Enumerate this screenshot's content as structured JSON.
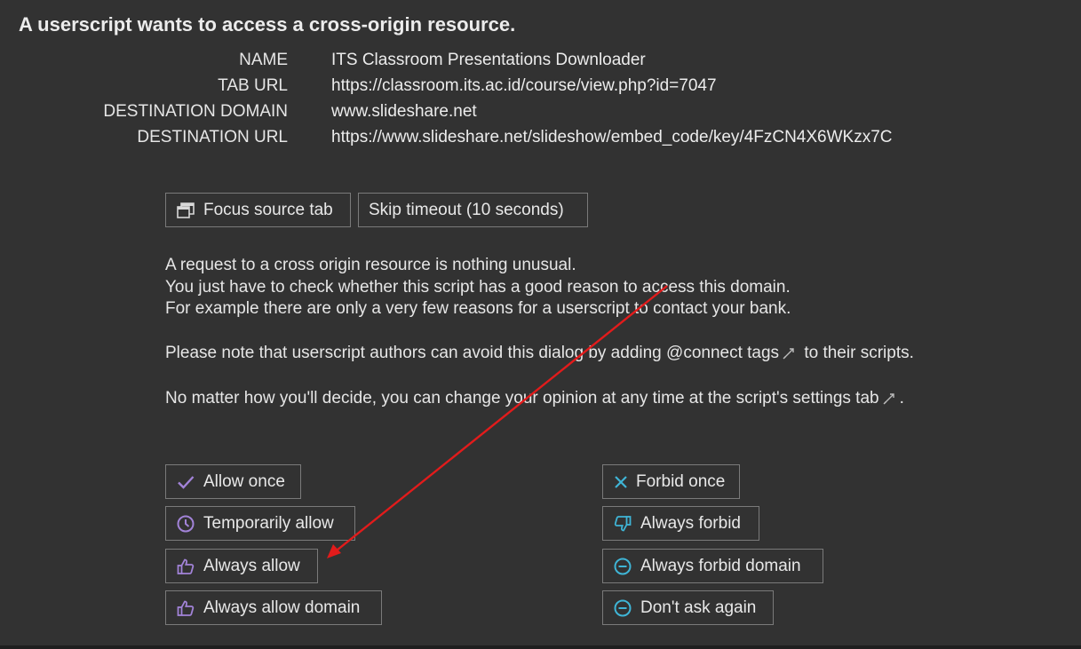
{
  "dialog": {
    "title": "A userscript wants to access a cross-origin resource."
  },
  "info": [
    {
      "key": "NAME",
      "value": "ITS Classroom Presentations Downloader"
    },
    {
      "key": "TAB URL",
      "value": "https://classroom.its.ac.id/course/view.php?id=7047"
    },
    {
      "key": "DESTINATION DOMAIN",
      "value": "www.slideshare.net"
    },
    {
      "key": "DESTINATION URL",
      "value": "https://www.slideshare.net/slideshow/embed_code/key/4FzCN4X6WKzx7C"
    }
  ],
  "top_buttons": {
    "focus_source_tab": "Focus source tab",
    "skip_timeout": "Skip timeout (10 seconds)"
  },
  "explanation": {
    "line1": "A request to a cross origin resource is nothing unusual.",
    "line2": "You just have to check whether this script has a good reason to access this domain.",
    "line3": "For example there are only a very few reasons for a userscript to contact your bank.",
    "note_before": "Please note that userscript authors can avoid this dialog by adding ",
    "note_link": "@connect tags",
    "note_after": " to their scripts.",
    "decide_before": "No matter how you'll decide, you can change your opinion at any time at the script's ",
    "decide_link": "settings tab",
    "decide_after": "."
  },
  "allow_buttons": {
    "allow_once": "Allow once",
    "temporarily_allow": "Temporarily allow",
    "always_allow": "Always allow",
    "always_allow_domain": "Always allow domain"
  },
  "forbid_buttons": {
    "forbid_once": "Forbid once",
    "always_forbid": "Always forbid",
    "always_forbid_domain": "Always forbid domain",
    "dont_ask_again": "Don't ask again"
  },
  "icons": {
    "focus": "window-restore-icon",
    "allow_once": "check-icon",
    "temporarily_allow": "clock-icon",
    "always_allow": "thumbs-up-icon",
    "always_allow_domain": "thumbs-up-icon",
    "forbid_once": "x-icon",
    "always_forbid": "thumbs-down-icon",
    "always_forbid_domain": "minus-circle-icon",
    "dont_ask_again": "minus-circle-icon",
    "external_link": "external-link-icon"
  },
  "colors": {
    "background": "#323232",
    "text": "#e8e8e8",
    "allow_icon": "#a283d8",
    "forbid_icon": "#3fb5d6",
    "annotation_arrow": "#e21b1b",
    "button_border": "#7a7a7a"
  }
}
